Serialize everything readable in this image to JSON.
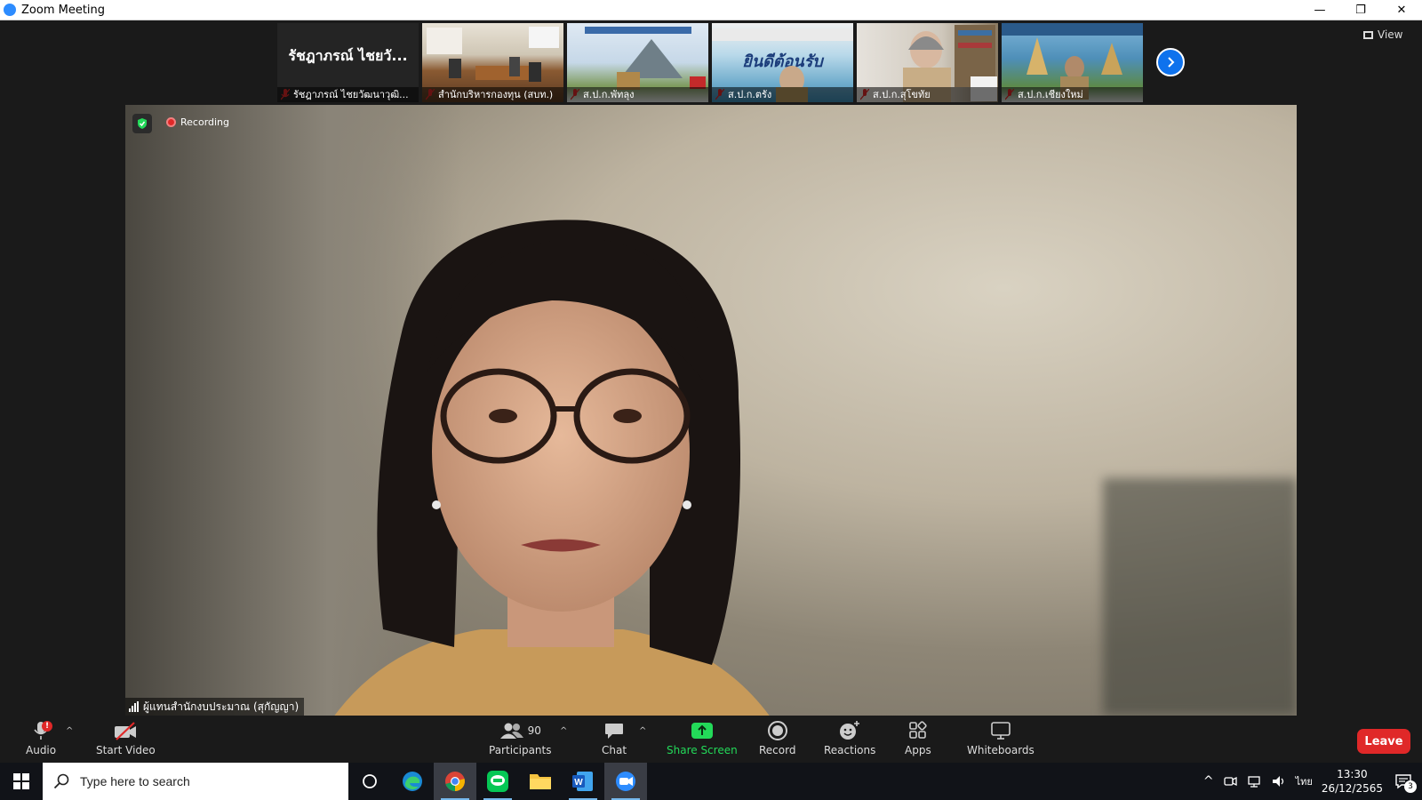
{
  "window": {
    "title": "Zoom Meeting",
    "minimize": "—",
    "restore": "❐",
    "close": "✕"
  },
  "gallery": {
    "name_tile_big": "รัชฎาภรณ์ ไชยวั...",
    "thumbnails": [
      {
        "label": "รัชฎาภรณ์ ไชยวัฒนาวุฒิ..."
      },
      {
        "label": "สำนักบริหารกองทุน (สบท.)"
      },
      {
        "label": "ส.ป.ก.พัทลุง"
      },
      {
        "label": "ส.ป.ก.ตรัง"
      },
      {
        "label": "ส.ป.ก.สุโขทัย"
      },
      {
        "label": "ส.ป.ก.เชียงใหม่"
      }
    ],
    "banner_text": "ยินดีต้อนรับ",
    "view_label": "View"
  },
  "video": {
    "recording_label": "Recording",
    "speaker_name": "ผู้แทนสำนักงบประมาณ (สุกัญญา)"
  },
  "toolbar": {
    "audio_label": "Audio",
    "audio_badge": "!",
    "video_label": "Start Video",
    "participants_label": "Participants",
    "participants_count": "90",
    "chat_label": "Chat",
    "share_label": "Share Screen",
    "record_label": "Record",
    "reactions_label": "Reactions",
    "apps_label": "Apps",
    "whiteboards_label": "Whiteboards",
    "leave_label": "Leave",
    "share_color": "#23d959",
    "leave_color": "#e02828"
  },
  "taskbar": {
    "search_placeholder": "Type here to search",
    "language": "ไทย",
    "time": "13:30",
    "date": "26/12/2565",
    "notification_count": "3"
  }
}
